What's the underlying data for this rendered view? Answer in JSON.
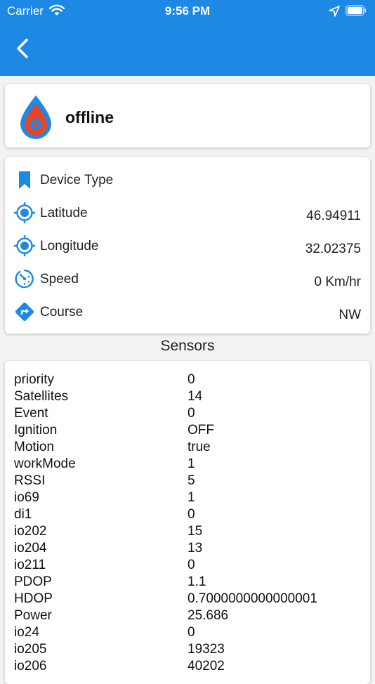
{
  "status_bar": {
    "carrier": "Carrier",
    "time": "9:56 PM"
  },
  "header": {
    "back_icon": "chevron-left-icon",
    "accent": "#1e88e5"
  },
  "device": {
    "status": "offline",
    "icon": "drop-pin-icon"
  },
  "info": [
    {
      "label": "Device Type",
      "value": "",
      "icon": "bookmark-icon"
    },
    {
      "label": "Latitude",
      "value": "46.94911",
      "icon": "crosshair-icon"
    },
    {
      "label": "Longitude",
      "value": "32.02375",
      "icon": "crosshair-icon"
    },
    {
      "label": "Speed",
      "value": "0 Km/hr",
      "icon": "speedometer-icon"
    },
    {
      "label": "Course",
      "value": "NW",
      "icon": "direction-icon"
    }
  ],
  "sensors": {
    "heading": "Sensors",
    "rows": [
      {
        "key": "priority",
        "value": "0"
      },
      {
        "key": "Satellites",
        "value": "14"
      },
      {
        "key": "Event",
        "value": "0"
      },
      {
        "key": "Ignition",
        "value": "OFF"
      },
      {
        "key": "Motion",
        "value": "true"
      },
      {
        "key": "workMode",
        "value": "1"
      },
      {
        "key": "RSSI",
        "value": "5"
      },
      {
        "key": "io69",
        "value": "1"
      },
      {
        "key": "di1",
        "value": "0"
      },
      {
        "key": "io202",
        "value": "15"
      },
      {
        "key": "io204",
        "value": "13"
      },
      {
        "key": "io211",
        "value": "0"
      },
      {
        "key": "PDOP",
        "value": "1.1"
      },
      {
        "key": "HDOP",
        "value": "0.7000000000000001"
      },
      {
        "key": "Power",
        "value": "25.686"
      },
      {
        "key": "io24",
        "value": "0"
      },
      {
        "key": "io205",
        "value": "19323"
      },
      {
        "key": "io206",
        "value": "40202"
      }
    ]
  }
}
